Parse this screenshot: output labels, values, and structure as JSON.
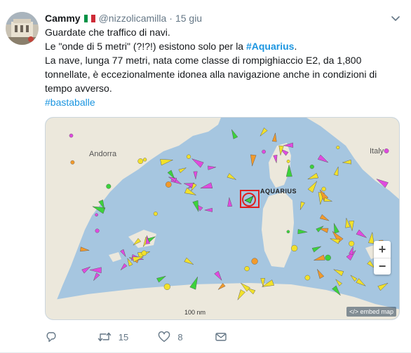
{
  "tweet": {
    "author_name": "Cammy",
    "author_handle": "@nizzolicamilla",
    "separator": "·",
    "time": "15 giu",
    "lines": {
      "l1": "Guardate che traffico di navi.",
      "l2_pre": "Le \"onde di 5 metri\" (?!?!) esistono solo per la ",
      "l2_tag": "#Aquarius",
      "l2_post": ".",
      "l3": "La nave, lunga 77 metri, nata come classe di rompighiaccio E2, da 1,800",
      "l4": "tonnellate, è eccezionalmente idonea alla navigazione anche in condizioni di",
      "l5": "tempo avverso.",
      "l6_tag": "#bastaballe"
    }
  },
  "flag_colors": [
    "#009246",
    "#ffffff",
    "#ce2b37"
  ],
  "map": {
    "labels": {
      "andorra": "Andorra",
      "italy": "Italy",
      "aquarius": "AQUARIUS"
    },
    "scale": "100 nm",
    "embed": "</> embed map",
    "zoom_in": "+",
    "zoom_out": "−",
    "colors": {
      "sea": "#a6c6e0",
      "land": "#ece8dc",
      "vessel_green": "#3cd23c",
      "vessel_yellow": "#f2e12b",
      "vessel_magenta": "#e04adf",
      "vessel_orange": "#f29a2b",
      "highlight": "#e02020"
    }
  },
  "actions": {
    "replies": "",
    "retweets": "15",
    "likes": "8"
  },
  "icons": {
    "caret": "chevron-down-icon",
    "reply": "reply-icon",
    "retweet": "retweet-icon",
    "like": "heart-icon",
    "dm": "mail-icon"
  }
}
